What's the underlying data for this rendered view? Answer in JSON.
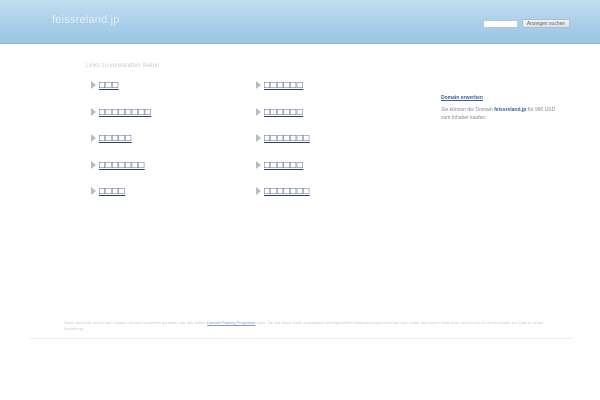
{
  "header": {
    "site_title": "feissreland.jp",
    "search_placeholder": "",
    "search_button_label": "Anzeigen suchen"
  },
  "links": {
    "heading": "Links zu verwandten Seiten",
    "left_column": [
      {
        "label": "□□□"
      },
      {
        "label": "□□□□□□□□"
      },
      {
        "label": "□□□□□"
      },
      {
        "label": "□□□□□□□"
      },
      {
        "label": "□□□□"
      }
    ],
    "right_column": [
      {
        "label": "□□□□□□"
      },
      {
        "label": "□□□□□□"
      },
      {
        "label": "□□□□□□□"
      },
      {
        "label": "□□□□□□"
      },
      {
        "label": "□□□□□□□"
      }
    ]
  },
  "sidebar": {
    "heading": "Domain erwerben",
    "text_before": "Sie können die Domain ",
    "domain_name": "feissreland.jp",
    "text_after": " für 990 USD zum Inhaber kaufen."
  },
  "footer": {
    "text_before": "Diese Webseite wurde vom Domain-Inhaber kostenfrei generiert, der das Seiten-",
    "link_label": "Domain Parking Programm",
    "text_after": " nutzt. Sie auf dieser Seite automatisch bereitgestellten Werbeanzeigen beziehen sich weder auf unsere Seite noch können wir für deren Inhalte zur Seite in keiner Beziehung."
  },
  "colors": {
    "header_bar": "#a8cde8",
    "link_text": "#2a3f6a",
    "accent_link": "#3a5f9c"
  }
}
